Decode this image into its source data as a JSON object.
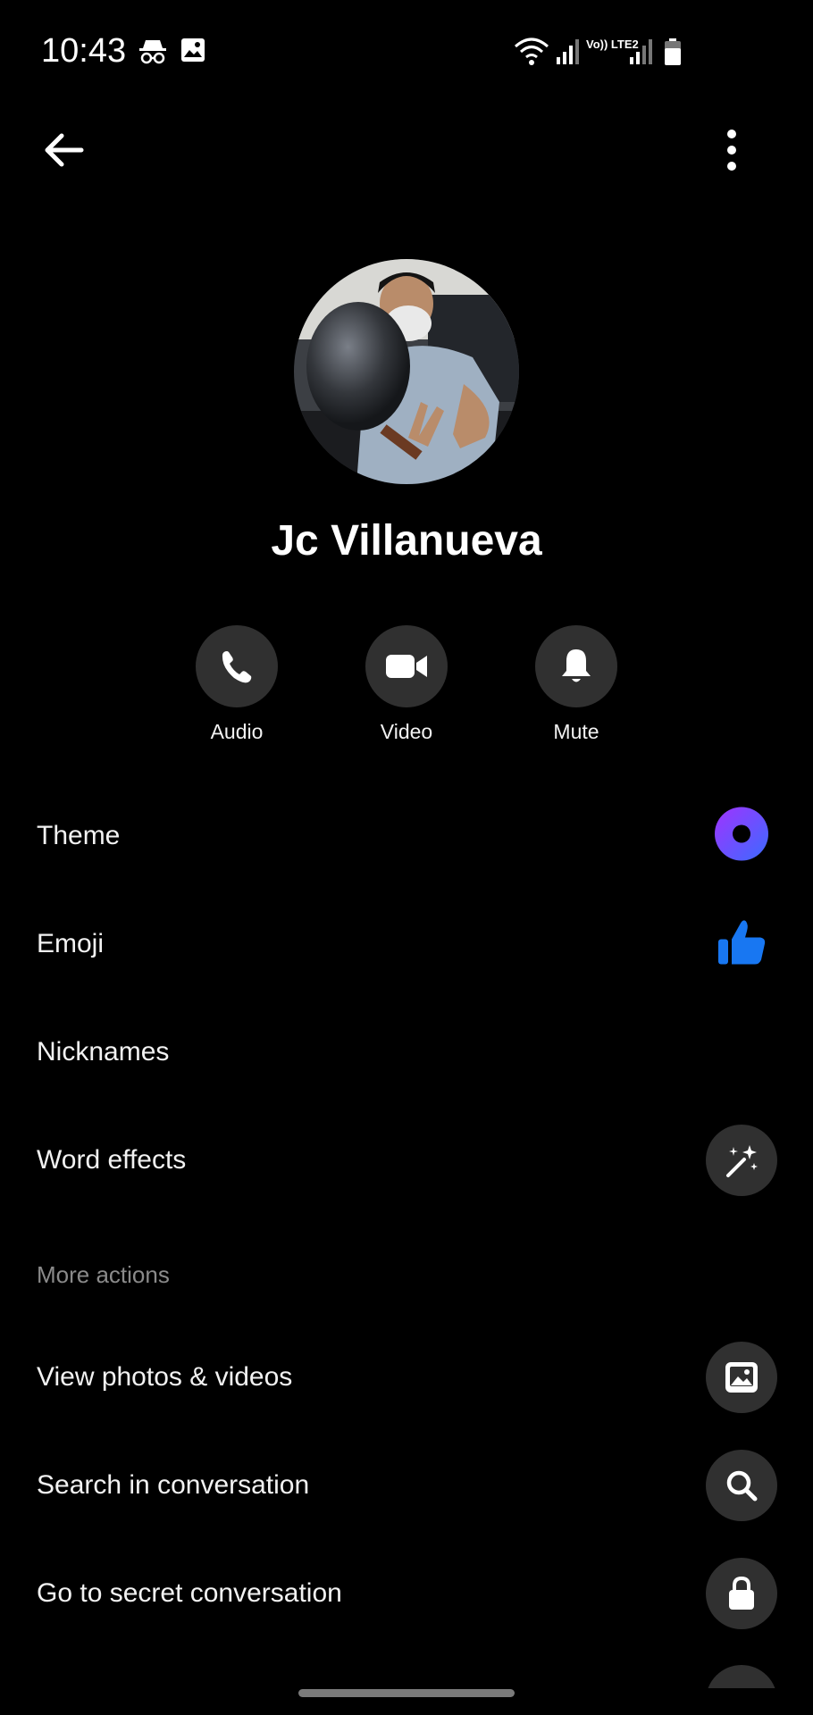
{
  "status_bar": {
    "time": "10:43",
    "network_label": "Vo)) LTE2",
    "icons": [
      "incognito-icon",
      "image-icon",
      "wifi-icon",
      "signal-icon",
      "signal2-icon",
      "battery-icon"
    ]
  },
  "top_bar": {
    "back_icon": "back-arrow-icon",
    "menu_icon": "more-vertical-icon"
  },
  "profile": {
    "name": "Jc Villanueva"
  },
  "actions": [
    {
      "label": "Audio",
      "icon": "phone-icon"
    },
    {
      "label": "Video",
      "icon": "video-camera-icon"
    },
    {
      "label": "Mute",
      "icon": "bell-icon"
    }
  ],
  "settings": [
    {
      "label": "Theme",
      "icon": "theme-circle-icon"
    },
    {
      "label": "Emoji",
      "icon": "thumbs-up-icon"
    },
    {
      "label": "Nicknames"
    },
    {
      "label": "Word effects",
      "icon": "magic-wand-icon"
    }
  ],
  "more_actions": {
    "title": "More actions",
    "items": [
      {
        "label": "View photos & videos",
        "icon": "photo-icon"
      },
      {
        "label": "Search in conversation",
        "icon": "search-icon"
      },
      {
        "label": "Go to secret conversation",
        "icon": "lock-icon"
      }
    ]
  },
  "colors": {
    "background": "#000000",
    "button_bg": "#303030",
    "accent_blue": "#1877f2",
    "theme_purple": "#8a3ffc",
    "muted_text": "#8a8a8a"
  }
}
